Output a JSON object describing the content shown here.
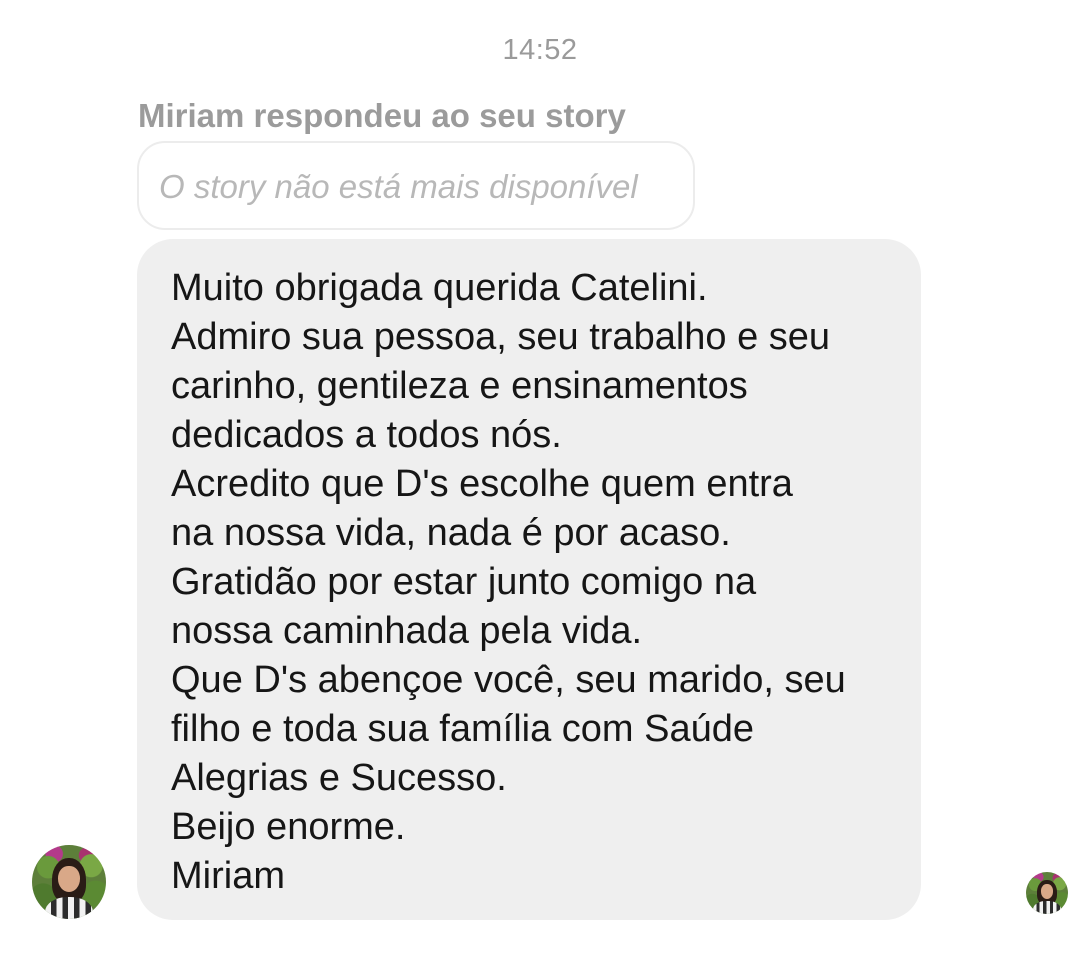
{
  "conversation": {
    "timestamp": "14:52",
    "reply_context": "Miriam respondeu ao seu story",
    "story_unavailable": "O story não está mais disponível"
  },
  "message": {
    "lines": [
      "Muito obrigada querida Catelini.",
      "Admiro sua pessoa, seu trabalho e seu",
      "carinho, gentileza e ensinamentos",
      "dedicados a todos nós.",
      "Acredito que D's escolhe quem entra",
      "na nossa vida, nada é por acaso.",
      "Gratidão por estar junto comigo na",
      "nossa caminhada pela vida.",
      "Que D's abençoe você, seu marido, seu",
      "filho e toda sua família com Saúde",
      "Alegrias e Sucesso.",
      "Beijo enorme.",
      "Miriam"
    ]
  },
  "avatars": {
    "sender_icon": "profile-photo",
    "seen_icon": "seen-receipt-profile-photo"
  },
  "colors": {
    "background": "#ffffff",
    "bubble": "#efefef",
    "muted_text": "#9b9b9b",
    "message_text": "#161616"
  }
}
